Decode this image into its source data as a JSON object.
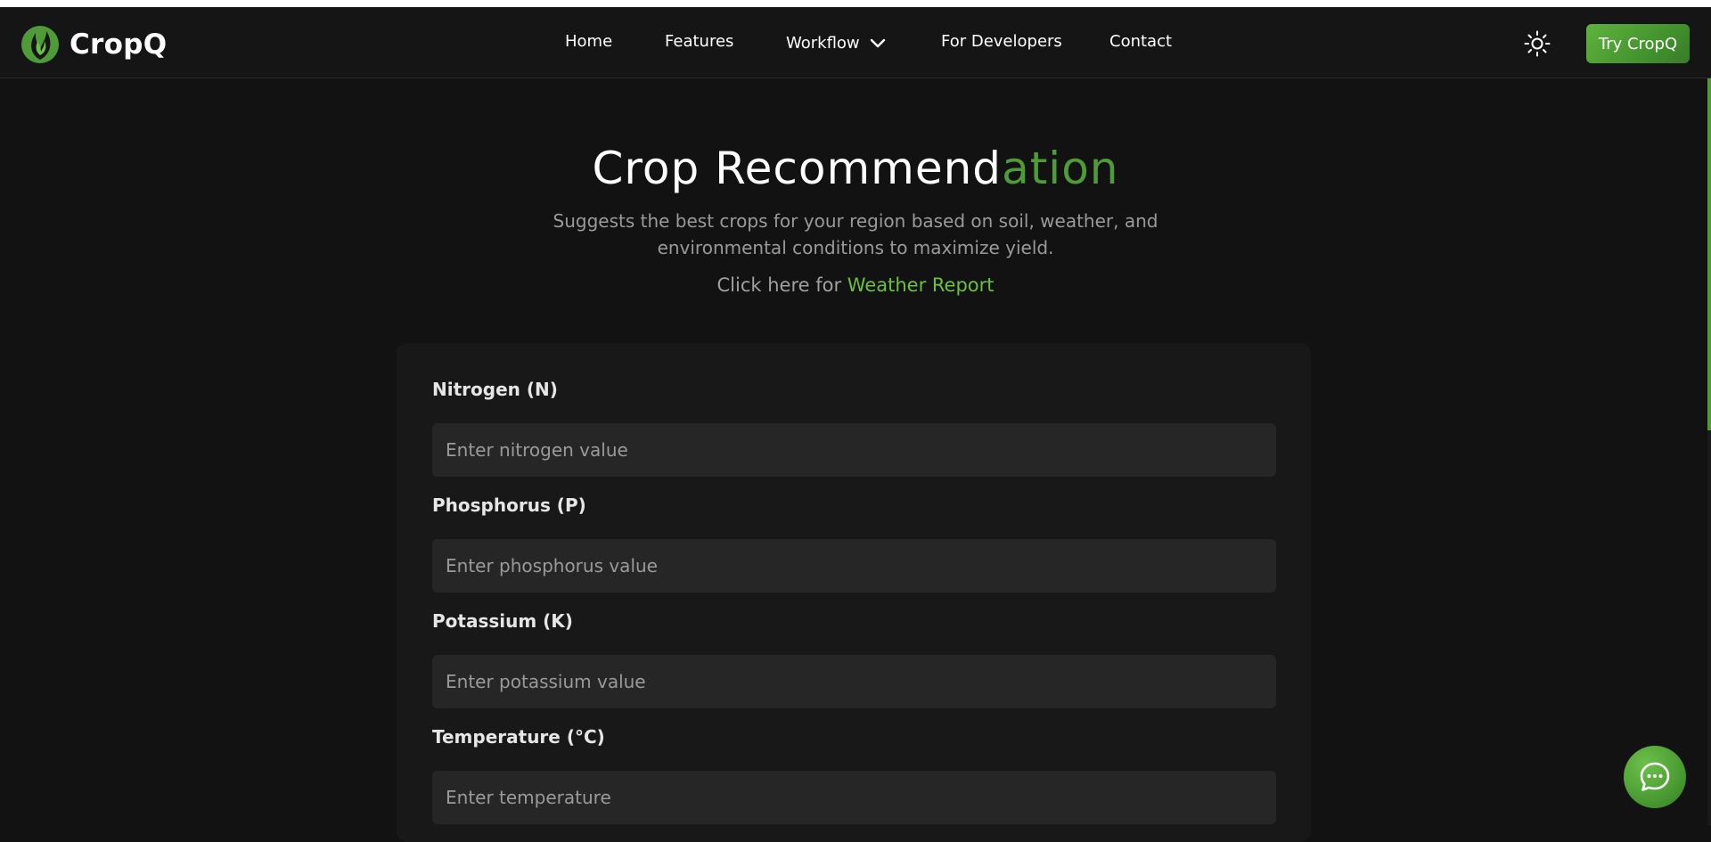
{
  "brand": {
    "name": "CropQ"
  },
  "nav": {
    "links": [
      {
        "label": "Home"
      },
      {
        "label": "Features"
      },
      {
        "label": "Workflow"
      },
      {
        "label": "For Developers"
      },
      {
        "label": "Contact"
      }
    ],
    "cta_label": "Try CropQ"
  },
  "hero": {
    "title_part1": "Crop Recommend",
    "title_part2": "ation",
    "subtitle": "Suggests the best crops for your region based on soil, weather, and environmental conditions to maximize yield.",
    "link_prefix": "Click here for",
    "link_text": "Weather Report"
  },
  "form": {
    "fields": [
      {
        "label": "Nitrogen (N)",
        "placeholder": "Enter nitrogen value"
      },
      {
        "label": "Phosphorus (P)",
        "placeholder": "Enter phosphorus value"
      },
      {
        "label": "Potassium (K)",
        "placeholder": "Enter potassium value"
      },
      {
        "label": "Temperature (°C)",
        "placeholder": "Enter temperature"
      }
    ]
  },
  "colors": {
    "accent": "#4f9b38",
    "link": "#69c043",
    "background": "#121212",
    "card": "#181818",
    "input": "#262626"
  },
  "icons": {
    "logo": "leaf-flame-icon",
    "theme": "sun-icon",
    "dropdown": "chevron-down-icon",
    "chat": "chat-bubble-icon"
  }
}
